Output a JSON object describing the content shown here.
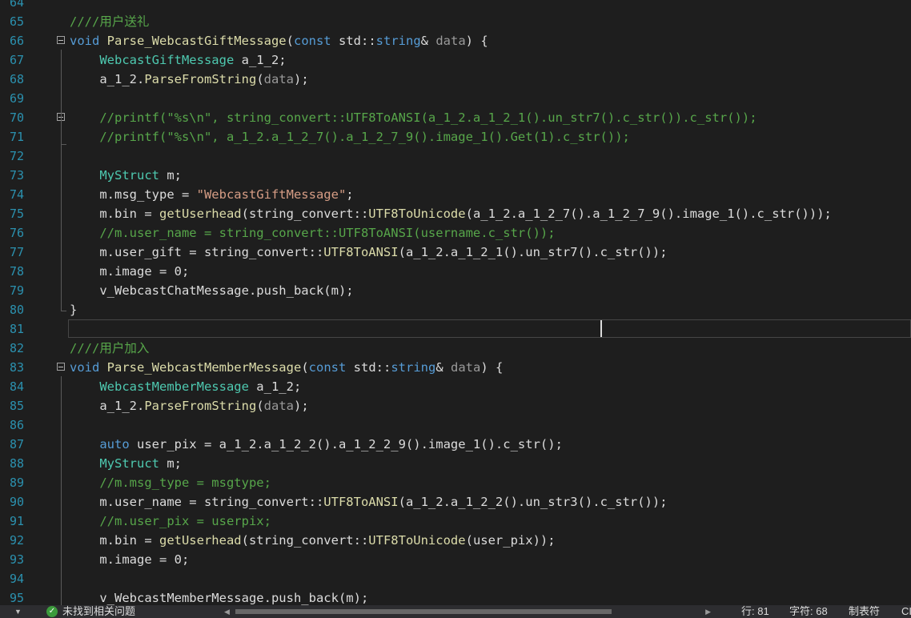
{
  "editor": {
    "lines": [
      {
        "n": "64",
        "code": []
      },
      {
        "n": "65",
        "code": [
          [
            "cm",
            "////用户送礼"
          ]
        ]
      },
      {
        "n": "66",
        "fold": true,
        "code": [
          [
            "kw",
            "void"
          ],
          [
            "tx",
            " "
          ],
          [
            "fn",
            "Parse_WebcastGiftMessage"
          ],
          [
            "tx",
            "("
          ],
          [
            "kw",
            "const"
          ],
          [
            "tx",
            " std::"
          ],
          [
            "kw",
            "string"
          ],
          [
            "tx",
            "& "
          ],
          [
            "pm",
            "data"
          ],
          [
            "tx",
            ") {"
          ]
        ]
      },
      {
        "n": "67",
        "code": [
          [
            "tx",
            "    "
          ],
          [
            "ty",
            "WebcastGiftMessage"
          ],
          [
            "tx",
            " a_1_2;"
          ]
        ]
      },
      {
        "n": "68",
        "code": [
          [
            "tx",
            "    a_1_2."
          ],
          [
            "fn",
            "ParseFromString"
          ],
          [
            "tx",
            "("
          ],
          [
            "pm",
            "data"
          ],
          [
            "tx",
            ");"
          ]
        ]
      },
      {
        "n": "69",
        "code": []
      },
      {
        "n": "70",
        "fold": true,
        "code": [
          [
            "tx",
            "    "
          ],
          [
            "cm",
            "//printf(\"%s\\n\", string_convert::UTF8ToANSI(a_1_2.a_1_2_1().un_str7().c_str()).c_str());"
          ]
        ]
      },
      {
        "n": "71",
        "code": [
          [
            "tx",
            "    "
          ],
          [
            "cm",
            "//printf(\"%s\\n\", a_1_2.a_1_2_7().a_1_2_7_9().image_1().Get(1).c_str());"
          ]
        ]
      },
      {
        "n": "72",
        "code": []
      },
      {
        "n": "73",
        "code": [
          [
            "tx",
            "    "
          ],
          [
            "ty",
            "MyStruct"
          ],
          [
            "tx",
            " m;"
          ]
        ]
      },
      {
        "n": "74",
        "code": [
          [
            "tx",
            "    m.msg_type = "
          ],
          [
            "st",
            "\"WebcastGiftMessage\""
          ],
          [
            "tx",
            ";"
          ]
        ]
      },
      {
        "n": "75",
        "code": [
          [
            "tx",
            "    m.bin = "
          ],
          [
            "fn",
            "getUserhead"
          ],
          [
            "tx",
            "(string_convert::"
          ],
          [
            "fn",
            "UTF8ToUnicode"
          ],
          [
            "tx",
            "(a_1_2.a_1_2_7().a_1_2_7_9().image_1().c_str()));"
          ]
        ]
      },
      {
        "n": "76",
        "code": [
          [
            "tx",
            "    "
          ],
          [
            "cm",
            "//m.user_name = string_convert::UTF8ToANSI(username.c_str());"
          ]
        ]
      },
      {
        "n": "77",
        "code": [
          [
            "tx",
            "    m.user_gift = string_convert::"
          ],
          [
            "fn",
            "UTF8ToANSI"
          ],
          [
            "tx",
            "(a_1_2.a_1_2_1().un_str7().c_str());"
          ]
        ]
      },
      {
        "n": "78",
        "code": [
          [
            "tx",
            "    m.image = 0;"
          ]
        ]
      },
      {
        "n": "79",
        "code": [
          [
            "tx",
            "    v_WebcastChatMessage.push_back(m);"
          ]
        ]
      },
      {
        "n": "80",
        "code": [
          [
            "tx",
            "}"
          ]
        ]
      },
      {
        "n": "81",
        "code": []
      },
      {
        "n": "82",
        "code": [
          [
            "cm",
            "////用户加入"
          ]
        ]
      },
      {
        "n": "83",
        "fold": true,
        "code": [
          [
            "kw",
            "void"
          ],
          [
            "tx",
            " "
          ],
          [
            "fn",
            "Parse_WebcastMemberMessage"
          ],
          [
            "tx",
            "("
          ],
          [
            "kw",
            "const"
          ],
          [
            "tx",
            " std::"
          ],
          [
            "kw",
            "string"
          ],
          [
            "tx",
            "& "
          ],
          [
            "pm",
            "data"
          ],
          [
            "tx",
            ") {"
          ]
        ]
      },
      {
        "n": "84",
        "code": [
          [
            "tx",
            "    "
          ],
          [
            "ty",
            "WebcastMemberMessage"
          ],
          [
            "tx",
            " a_1_2;"
          ]
        ]
      },
      {
        "n": "85",
        "code": [
          [
            "tx",
            "    a_1_2."
          ],
          [
            "fn",
            "ParseFromString"
          ],
          [
            "tx",
            "("
          ],
          [
            "pm",
            "data"
          ],
          [
            "tx",
            ");"
          ]
        ]
      },
      {
        "n": "86",
        "code": []
      },
      {
        "n": "87",
        "code": [
          [
            "tx",
            "    "
          ],
          [
            "kw",
            "auto"
          ],
          [
            "tx",
            " user_pix = a_1_2.a_1_2_2().a_1_2_2_9().image_1().c_str();"
          ]
        ]
      },
      {
        "n": "88",
        "code": [
          [
            "tx",
            "    "
          ],
          [
            "ty",
            "MyStruct"
          ],
          [
            "tx",
            " m;"
          ]
        ]
      },
      {
        "n": "89",
        "code": [
          [
            "tx",
            "    "
          ],
          [
            "cm",
            "//m.msg_type = msgtype;"
          ]
        ]
      },
      {
        "n": "90",
        "code": [
          [
            "tx",
            "    m.user_name = string_convert::"
          ],
          [
            "fn",
            "UTF8ToANSI"
          ],
          [
            "tx",
            "(a_1_2.a_1_2_2().un_str3().c_str());"
          ]
        ]
      },
      {
        "n": "91",
        "code": [
          [
            "tx",
            "    "
          ],
          [
            "cm",
            "//m.user_pix = userpix;"
          ]
        ]
      },
      {
        "n": "92",
        "code": [
          [
            "tx",
            "    m.bin = "
          ],
          [
            "fn",
            "getUserhead"
          ],
          [
            "tx",
            "(string_convert::"
          ],
          [
            "fn",
            "UTF8ToUnicode"
          ],
          [
            "tx",
            "(user_pix));"
          ]
        ]
      },
      {
        "n": "93",
        "code": [
          [
            "tx",
            "    m.image = 0;"
          ]
        ]
      },
      {
        "n": "94",
        "code": []
      },
      {
        "n": "95",
        "code": [
          [
            "tx",
            "    v_WebcastMemberMessage.push_back(m);"
          ]
        ]
      }
    ]
  },
  "status": {
    "issues_text": "未找到相关问题",
    "line": "行: 81",
    "char": "字符: 68",
    "tab_mode": "制表符",
    "crlf": "CI"
  }
}
